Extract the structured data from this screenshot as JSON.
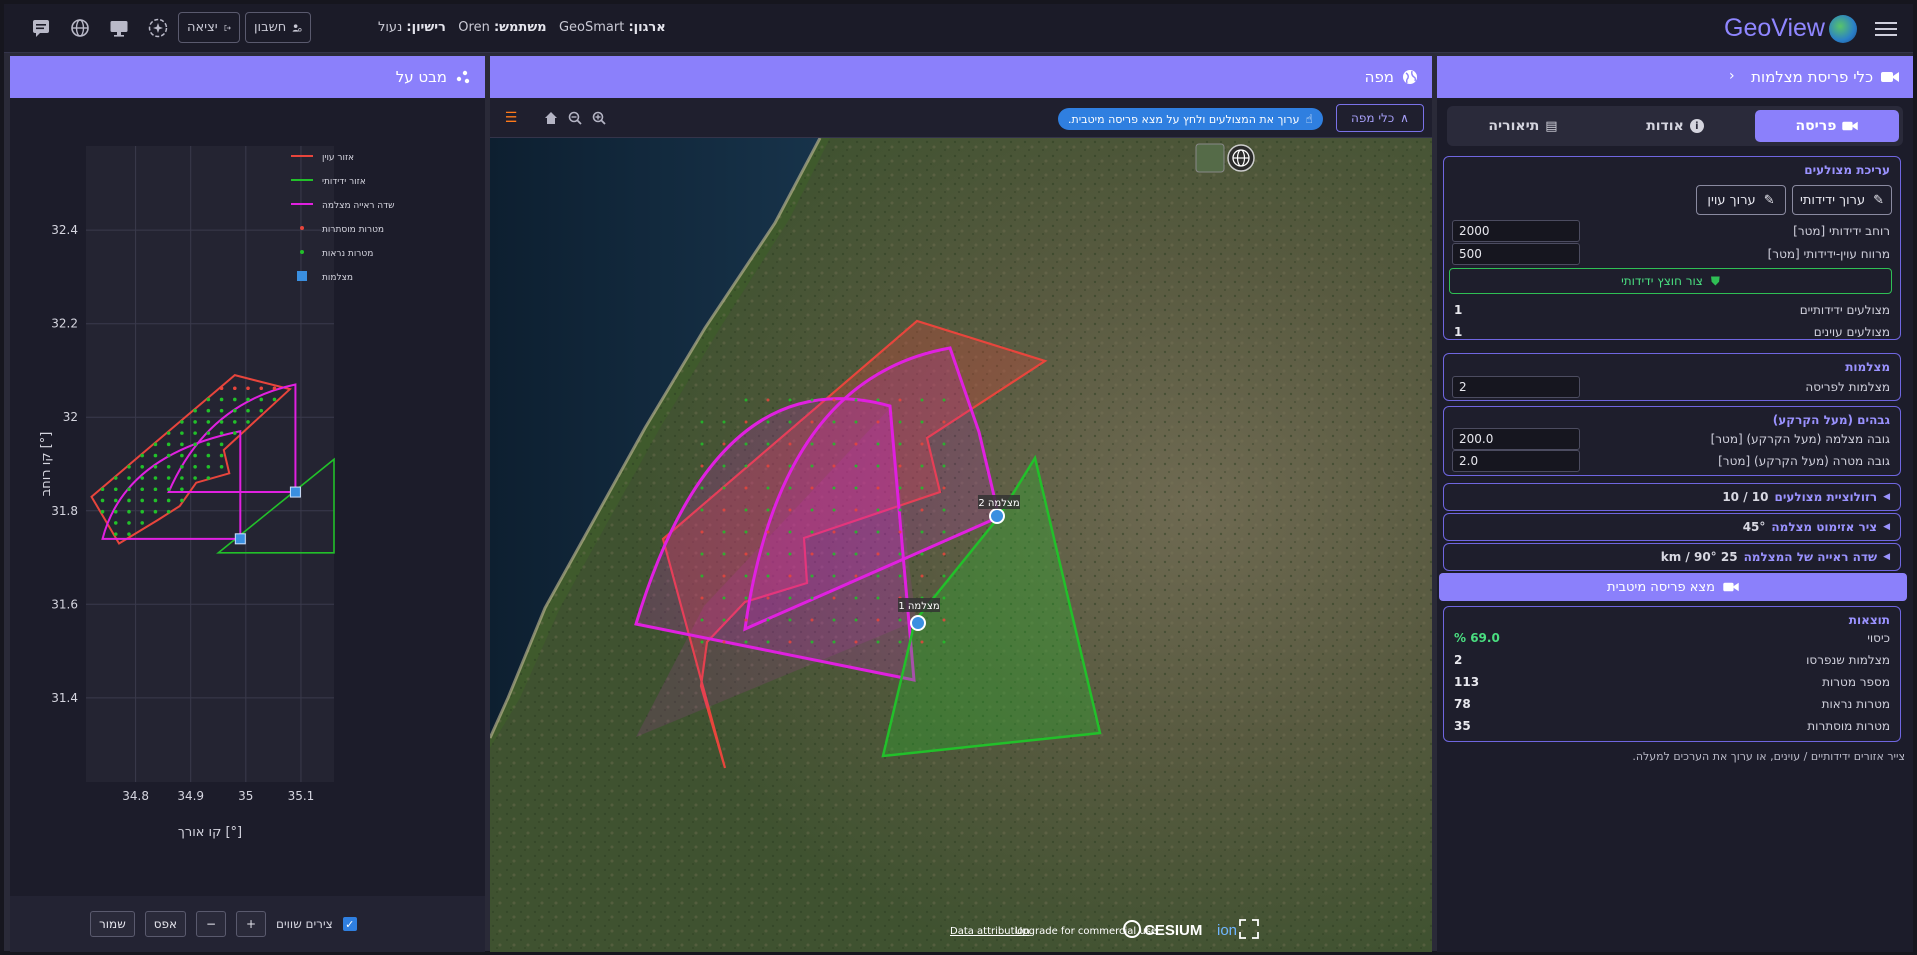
{
  "header": {
    "brand": "GeoView",
    "org_label": "ארגון:",
    "org_value": "GeoSmart",
    "user_label": "משתמש:",
    "user_value": "Oren",
    "license_label": "רישיון:",
    "license_value": "נעול",
    "account_button": "חשבון",
    "logout_button": "יציאה"
  },
  "left_panel": {
    "title": "מבט על",
    "legend": [
      {
        "label": "אזור עוין",
        "color": "#e8453c",
        "kind": "line"
      },
      {
        "label": "אזור ידידותי",
        "color": "#22c02a",
        "kind": "line"
      },
      {
        "label": "שדה ראייה מצלמה",
        "color": "#e020e0",
        "kind": "line"
      },
      {
        "label": "מטרות מוסתרות",
        "color": "#e8453c",
        "kind": "dot"
      },
      {
        "label": "מטרות נראות",
        "color": "#22c02a",
        "kind": "dot"
      },
      {
        "label": "מצלמות",
        "color": "#3a8fe0",
        "kind": "square"
      }
    ],
    "y_label": "קו רוחב [°]",
    "x_label": "קו אורך [°]",
    "y_ticks": [
      "32.4",
      "32.2",
      "32",
      "31.8",
      "31.6",
      "31.4"
    ],
    "x_ticks": [
      "34.8",
      "34.9",
      "35",
      "35.1"
    ],
    "footer": {
      "equal_axes_label": "צירים שווים",
      "plus": "+",
      "minus": "−",
      "reset": "אפס",
      "save": "שמור"
    }
  },
  "map_panel": {
    "title": "מפה",
    "hint": "ערוך את המצולעים ולחץ על מצא פריסה מיטבית.",
    "map_tools_button": "כלי מפה",
    "camera_labels": [
      "מצלמה 1",
      "מצלמה 2"
    ],
    "attribution": "Data attribution",
    "upgrade": "Upgrade for commercial use",
    "cesium": "CESIUM",
    "ion": "ion"
  },
  "right_panel": {
    "title": "כלי פריסת מצלמות",
    "tabs": {
      "deploy": "פריסה",
      "about": "אודות",
      "theory": "תיאוריה"
    },
    "polygon_edit": {
      "title": "עריכת מצולעים",
      "edit_friendly": "ערוך ידידותי",
      "edit_hostile": "ערוך עוין",
      "friendly_width_label": "רוחב ידידותי [מטר]",
      "friendly_width_value": "2000",
      "gap_label": "מרווח עוין-ידידותי [מטר]",
      "gap_value": "500",
      "create_buffer": "צור חוצץ ידידותי",
      "friendly_count_label": "מצולעים ידידותיים",
      "friendly_count_value": "1",
      "hostile_count_label": "מצולעים עוינים",
      "hostile_count_value": "1"
    },
    "cameras": {
      "title": "מצלמות",
      "per_deploy_label": "מצלמות לפריסה",
      "per_deploy_value": "2"
    },
    "heights": {
      "title": "גבהים (מעל הקרקע)",
      "camera_height_label": "גובה מצלמה (מעל הקרקע) [מטר]",
      "camera_height_value": "200.0",
      "target_height_label": "גובה מטרה (מעל הקרקע) [מטר]",
      "target_height_value": "2.0"
    },
    "collapsibles": [
      {
        "title": "רזולוציית מצולעים",
        "value": "10 / 10"
      },
      {
        "title": "ציר אזימוט מצלמה",
        "value": "45°"
      },
      {
        "title": "שדה ראייה של המצלמה",
        "value": "25 km / 90°"
      }
    ],
    "find_button": "מצא פריסה מיטבית",
    "results": {
      "title": "תוצאות",
      "coverage_label": "כיסוי",
      "coverage_value": "69.0 %",
      "deployed_label": "מצלמות שנפרסו",
      "deployed_value": "2",
      "targets_label": "מספר מטרות",
      "targets_value": "113",
      "visible_label": "מטרות נראות",
      "visible_value": "78",
      "hidden_label": "מטרות מוסתרות",
      "hidden_value": "35"
    },
    "footnote": "צייר אזורים ידידותיים / עוינים, או ערוך את הערכים למעלה."
  },
  "colors": {
    "accent": "#8b80fb",
    "hostile": "#e8453c",
    "friendly": "#22c02a",
    "fov": "#e020e0",
    "camera": "#3a8fe0",
    "coverage": "#4ade80"
  }
}
